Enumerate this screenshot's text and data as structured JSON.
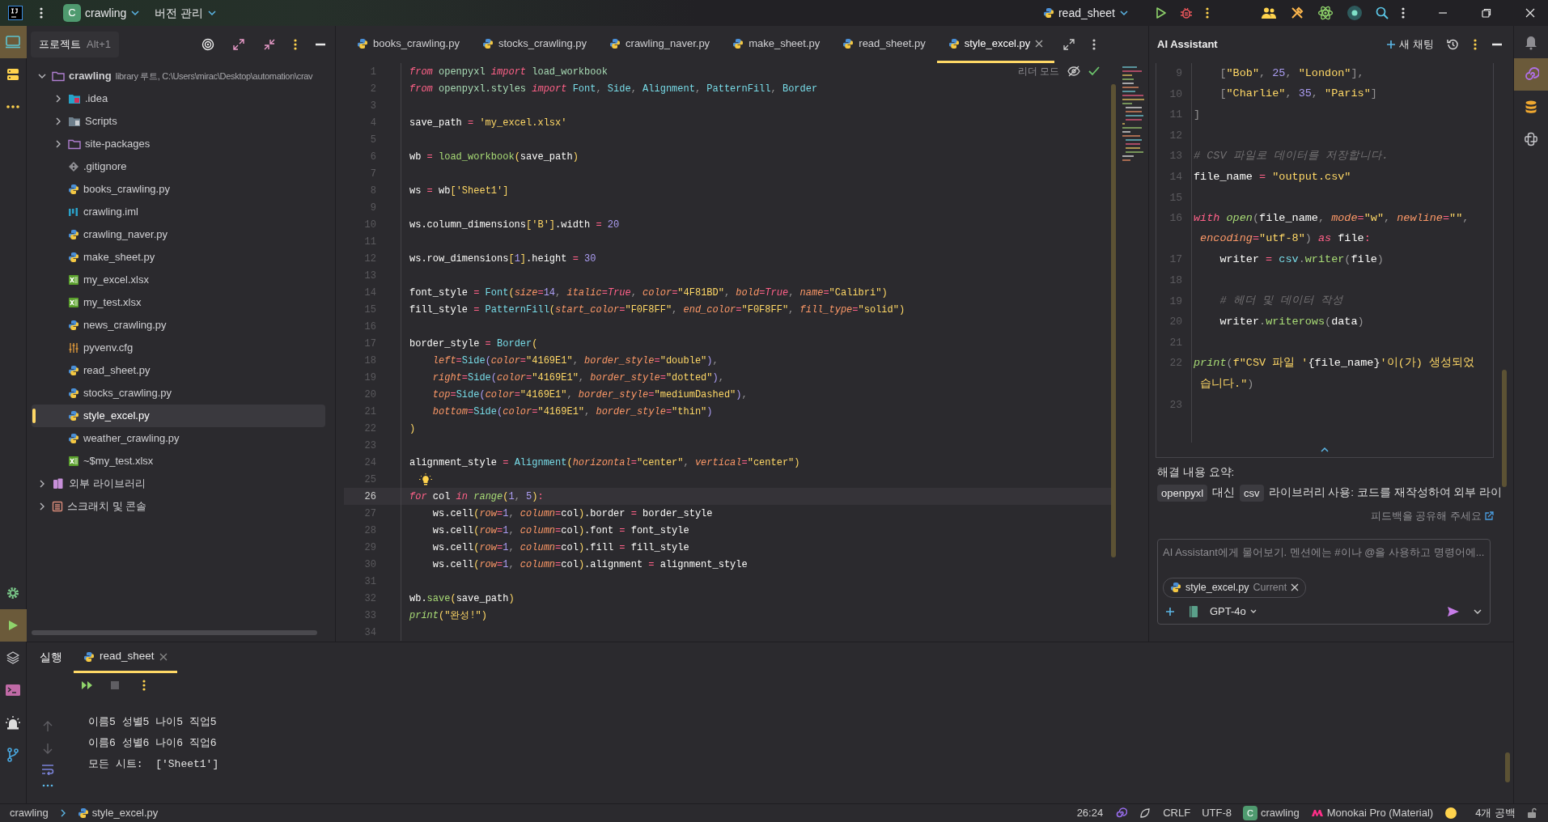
{
  "title_bar": {
    "project_badge": "C",
    "project": "crawling",
    "vcs": "버전 관리",
    "run_config": "read_sheet"
  },
  "left_toolbar": [
    {
      "kind": "project",
      "selected": true
    },
    {
      "kind": "services",
      "selected": false
    },
    {
      "kind": "more",
      "selected": false
    }
  ],
  "left_toolbar_bottom": [
    {
      "kind": "settings",
      "selected": false
    },
    {
      "kind": "run",
      "selected": true
    },
    {
      "kind": "layers",
      "selected": false
    },
    {
      "kind": "terminal",
      "selected": false
    },
    {
      "kind": "problems",
      "selected": false
    },
    {
      "kind": "git",
      "selected": false
    }
  ],
  "right_toolbar": [
    {
      "kind": "ai",
      "selected": true
    },
    {
      "kind": "database",
      "selected": false
    },
    {
      "kind": "python",
      "selected": false
    }
  ],
  "project_panel": {
    "tooltip_title": "프로젝트",
    "tooltip_shortcut": "Alt+1",
    "tree": [
      {
        "label": "crawling",
        "detail": "library 루트, C:\\Users\\mirac\\Desktop\\automation\\crav",
        "kind": "folder",
        "expanded": true,
        "selected": false,
        "children": [
          {
            "label": ".idea",
            "kind": "folder_idea",
            "expanded": false,
            "selected": false
          },
          {
            "label": "Scripts",
            "kind": "folder_scripts",
            "expanded": false,
            "selected": false
          },
          {
            "label": "site-packages",
            "kind": "folder",
            "expanded": false,
            "selected": false
          },
          {
            "label": ".gitignore",
            "kind": "git",
            "selected": false
          },
          {
            "label": "books_crawling.py",
            "kind": "python",
            "selected": false
          },
          {
            "label": "crawling.iml",
            "kind": "iml",
            "selected": false
          },
          {
            "label": "crawling_naver.py",
            "kind": "python",
            "selected": false
          },
          {
            "label": "make_sheet.py",
            "kind": "python",
            "selected": false
          },
          {
            "label": "my_excel.xlsx",
            "kind": "excel",
            "selected": false
          },
          {
            "label": "my_test.xlsx",
            "kind": "excel",
            "selected": false
          },
          {
            "label": "news_crawling.py",
            "kind": "python",
            "selected": false
          },
          {
            "label": "pyvenv.cfg",
            "kind": "cfg",
            "selected": false
          },
          {
            "label": "read_sheet.py",
            "kind": "python",
            "selected": false
          },
          {
            "label": "stocks_crawling.py",
            "kind": "python",
            "selected": false
          },
          {
            "label": "style_excel.py",
            "kind": "python",
            "selected": true
          },
          {
            "label": "weather_crawling.py",
            "kind": "python",
            "selected": false
          },
          {
            "label": "~$my_test.xlsx",
            "kind": "excel",
            "selected": false
          }
        ]
      },
      {
        "label": "외부 라이브러리",
        "kind": "library",
        "expanded": false,
        "selected": false
      },
      {
        "label": "스크래치 및 콘솔",
        "kind": "scratch",
        "expanded": false,
        "selected": false
      }
    ]
  },
  "editor": {
    "tabs": [
      {
        "label": "books_crawling.py",
        "selected": false
      },
      {
        "label": "stocks_crawling.py",
        "selected": false
      },
      {
        "label": "crawling_naver.py",
        "selected": false
      },
      {
        "label": "make_sheet.py",
        "selected": false
      },
      {
        "label": "read_sheet.py",
        "selected": false
      },
      {
        "label": "style_excel.py",
        "selected": true
      }
    ],
    "reader_mode": "리더 모드",
    "lines": [
      {
        "no": "1",
        "current": false,
        "code": [
          {
            "kind": "kw",
            "text": "from"
          },
          {
            "kind": "mod",
            "text": " openpyxl"
          },
          {
            "kind": "kw",
            "text": " import"
          },
          {
            "kind": "mod",
            "text": " load_workbook"
          }
        ]
      },
      {
        "no": "2",
        "current": false,
        "code": [
          {
            "kind": "kw",
            "text": "from"
          },
          {
            "kind": "mod",
            "text": " openpyxl.styles"
          },
          {
            "kind": "kw",
            "text": " import"
          },
          {
            "kind": "cls",
            "text": " Font"
          },
          {
            "kind": "pu",
            "text": ","
          },
          {
            "kind": "cls",
            "text": " Side"
          },
          {
            "kind": "pu",
            "text": ","
          },
          {
            "kind": "cls",
            "text": " Alignment"
          },
          {
            "kind": "pu",
            "text": ","
          },
          {
            "kind": "cls",
            "text": " PatternFill"
          },
          {
            "kind": "pu",
            "text": ","
          },
          {
            "kind": "cls",
            "text": " Border"
          }
        ]
      },
      {
        "no": "3",
        "current": false
      },
      {
        "no": "4",
        "current": false,
        "code": [
          {
            "kind": "p",
            "text": "save_path"
          },
          {
            "kind": "op",
            "text": " ="
          },
          {
            "kind": "str",
            "text": " 'my_excel.xlsx'"
          }
        ]
      },
      {
        "no": "5",
        "current": false
      },
      {
        "no": "6",
        "current": false,
        "code": [
          {
            "kind": "p",
            "text": "wb"
          },
          {
            "kind": "op",
            "text": " ="
          },
          {
            "kind": "fn",
            "text": " load_workbook"
          },
          {
            "kind": "br",
            "text": "("
          },
          {
            "kind": "p",
            "text": "save_path"
          },
          {
            "kind": "br",
            "text": ")"
          }
        ]
      },
      {
        "no": "7",
        "current": false
      },
      {
        "no": "8",
        "current": false,
        "code": [
          {
            "kind": "p",
            "text": "ws"
          },
          {
            "kind": "op",
            "text": " ="
          },
          {
            "kind": "p",
            "text": " wb"
          },
          {
            "kind": "br",
            "text": "["
          },
          {
            "kind": "str",
            "text": "'Sheet1'"
          },
          {
            "kind": "br",
            "text": "]"
          }
        ]
      },
      {
        "no": "9",
        "current": false
      },
      {
        "no": "10",
        "current": false,
        "code": [
          {
            "kind": "p",
            "text": "ws.column_dimensions"
          },
          {
            "kind": "br",
            "text": "["
          },
          {
            "kind": "str",
            "text": "'B'"
          },
          {
            "kind": "br",
            "text": "]"
          },
          {
            "kind": "p",
            "text": ".width"
          },
          {
            "kind": "op",
            "text": " ="
          },
          {
            "kind": "num",
            "text": " 20"
          }
        ]
      },
      {
        "no": "11",
        "current": false
      },
      {
        "no": "12",
        "current": false,
        "code": [
          {
            "kind": "p",
            "text": "ws.row_dimensions"
          },
          {
            "kind": "br",
            "text": "["
          },
          {
            "kind": "num",
            "text": "1"
          },
          {
            "kind": "br",
            "text": "]"
          },
          {
            "kind": "p",
            "text": ".height"
          },
          {
            "kind": "op",
            "text": " ="
          },
          {
            "kind": "num",
            "text": " 30"
          }
        ]
      },
      {
        "no": "13",
        "current": false
      },
      {
        "no": "14",
        "current": false,
        "code": [
          {
            "kind": "p",
            "text": "font_style"
          },
          {
            "kind": "op",
            "text": " ="
          },
          {
            "kind": "cls",
            "text": " Font"
          },
          {
            "kind": "br",
            "text": "("
          },
          {
            "kind": "prm",
            "text": "size"
          },
          {
            "kind": "op",
            "text": "="
          },
          {
            "kind": "num",
            "text": "14"
          },
          {
            "kind": "pu",
            "text": ","
          },
          {
            "kind": "prm",
            "text": " italic"
          },
          {
            "kind": "op",
            "text": "="
          },
          {
            "kind": "kw",
            "text": "True"
          },
          {
            "kind": "pu",
            "text": ","
          },
          {
            "kind": "prm",
            "text": " color"
          },
          {
            "kind": "op",
            "text": "="
          },
          {
            "kind": "str",
            "text": "\"4F81BD\""
          },
          {
            "kind": "pu",
            "text": ","
          },
          {
            "kind": "prm",
            "text": " bold"
          },
          {
            "kind": "op",
            "text": "="
          },
          {
            "kind": "kw",
            "text": "True"
          },
          {
            "kind": "pu",
            "text": ","
          },
          {
            "kind": "prm",
            "text": " name"
          },
          {
            "kind": "op",
            "text": "="
          },
          {
            "kind": "str",
            "text": "\"Calibri\""
          },
          {
            "kind": "br",
            "text": ")"
          }
        ]
      },
      {
        "no": "15",
        "current": false,
        "code": [
          {
            "kind": "p",
            "text": "fill_style"
          },
          {
            "kind": "op",
            "text": " ="
          },
          {
            "kind": "cls",
            "text": " PatternFill"
          },
          {
            "kind": "br",
            "text": "("
          },
          {
            "kind": "prm",
            "text": "start_color"
          },
          {
            "kind": "op",
            "text": "="
          },
          {
            "kind": "str",
            "text": "\"F0F8FF\""
          },
          {
            "kind": "pu",
            "text": ","
          },
          {
            "kind": "prm",
            "text": " end_color"
          },
          {
            "kind": "op",
            "text": "="
          },
          {
            "kind": "str",
            "text": "\"F0F8FF\""
          },
          {
            "kind": "pu",
            "text": ","
          },
          {
            "kind": "prm",
            "text": " fill_type"
          },
          {
            "kind": "op",
            "text": "="
          },
          {
            "kind": "str",
            "text": "\"solid\""
          },
          {
            "kind": "br",
            "text": ")"
          }
        ]
      },
      {
        "no": "16",
        "current": false
      },
      {
        "no": "17",
        "current": false,
        "code": [
          {
            "kind": "p",
            "text": "border_style"
          },
          {
            "kind": "op",
            "text": " ="
          },
          {
            "kind": "cls",
            "text": " Border"
          },
          {
            "kind": "br",
            "text": "("
          }
        ]
      },
      {
        "no": "18",
        "current": false,
        "code": [
          {
            "kind": "prm",
            "text": "    left"
          },
          {
            "kind": "op",
            "text": "="
          },
          {
            "kind": "cls",
            "text": "Side"
          },
          {
            "kind": "br2",
            "text": "("
          },
          {
            "kind": "prm",
            "text": "color"
          },
          {
            "kind": "op",
            "text": "="
          },
          {
            "kind": "str",
            "text": "\"4169E1\""
          },
          {
            "kind": "pu",
            "text": ","
          },
          {
            "kind": "prm",
            "text": " border_style"
          },
          {
            "kind": "op",
            "text": "="
          },
          {
            "kind": "str",
            "text": "\"double\""
          },
          {
            "kind": "br2",
            "text": ")"
          },
          {
            "kind": "pu",
            "text": ","
          }
        ]
      },
      {
        "no": "19",
        "current": false,
        "code": [
          {
            "kind": "prm",
            "text": "    right"
          },
          {
            "kind": "op",
            "text": "="
          },
          {
            "kind": "cls",
            "text": "Side"
          },
          {
            "kind": "br2",
            "text": "("
          },
          {
            "kind": "prm",
            "text": "color"
          },
          {
            "kind": "op",
            "text": "="
          },
          {
            "kind": "str",
            "text": "\"4169E1\""
          },
          {
            "kind": "pu",
            "text": ","
          },
          {
            "kind": "prm",
            "text": " border_style"
          },
          {
            "kind": "op",
            "text": "="
          },
          {
            "kind": "str",
            "text": "\"dotted\""
          },
          {
            "kind": "br2",
            "text": ")"
          },
          {
            "kind": "pu",
            "text": ","
          }
        ]
      },
      {
        "no": "20",
        "current": false,
        "code": [
          {
            "kind": "prm",
            "text": "    top"
          },
          {
            "kind": "op",
            "text": "="
          },
          {
            "kind": "cls",
            "text": "Side"
          },
          {
            "kind": "br2",
            "text": "("
          },
          {
            "kind": "prm",
            "text": "color"
          },
          {
            "kind": "op",
            "text": "="
          },
          {
            "kind": "str",
            "text": "\"4169E1\""
          },
          {
            "kind": "pu",
            "text": ","
          },
          {
            "kind": "prm",
            "text": " border_style"
          },
          {
            "kind": "op",
            "text": "="
          },
          {
            "kind": "str",
            "text": "\"mediumDashed\""
          },
          {
            "kind": "br2",
            "text": ")"
          },
          {
            "kind": "pu",
            "text": ","
          }
        ]
      },
      {
        "no": "21",
        "current": false,
        "code": [
          {
            "kind": "prm",
            "text": "    bottom"
          },
          {
            "kind": "op",
            "text": "="
          },
          {
            "kind": "cls",
            "text": "Side"
          },
          {
            "kind": "br2",
            "text": "("
          },
          {
            "kind": "prm",
            "text": "color"
          },
          {
            "kind": "op",
            "text": "="
          },
          {
            "kind": "str",
            "text": "\"4169E1\""
          },
          {
            "kind": "pu",
            "text": ","
          },
          {
            "kind": "prm",
            "text": " border_style"
          },
          {
            "kind": "op",
            "text": "="
          },
          {
            "kind": "str",
            "text": "\"thin\""
          },
          {
            "kind": "br2",
            "text": ")"
          }
        ]
      },
      {
        "no": "22",
        "current": false,
        "code": [
          {
            "kind": "br",
            "text": ")"
          }
        ]
      },
      {
        "no": "23",
        "current": false
      },
      {
        "no": "24",
        "current": false,
        "code": [
          {
            "kind": "p",
            "text": "alignment_style"
          },
          {
            "kind": "op",
            "text": " ="
          },
          {
            "kind": "cls",
            "text": " Alignment"
          },
          {
            "kind": "br",
            "text": "("
          },
          {
            "kind": "prm",
            "text": "horizontal"
          },
          {
            "kind": "op",
            "text": "="
          },
          {
            "kind": "str",
            "text": "\"center\""
          },
          {
            "kind": "pu",
            "text": ","
          },
          {
            "kind": "prm",
            "text": " vertical"
          },
          {
            "kind": "op",
            "text": "="
          },
          {
            "kind": "str",
            "text": "\"center\""
          },
          {
            "kind": "br",
            "text": ")"
          }
        ]
      },
      {
        "no": "25",
        "current": false,
        "bulb": true
      },
      {
        "no": "26",
        "current": true,
        "code": [
          {
            "kind": "kw",
            "text": "for"
          },
          {
            "kind": "p",
            "text": " col"
          },
          {
            "kind": "kw",
            "text": " in"
          },
          {
            "kind": "bi",
            "text": " range"
          },
          {
            "kind": "br",
            "text": "("
          },
          {
            "kind": "num",
            "text": "1"
          },
          {
            "kind": "pu",
            "text": ","
          },
          {
            "kind": "num",
            "text": " 5"
          },
          {
            "kind": "br",
            "text": ")"
          },
          {
            "kind": "op",
            "text": ":"
          }
        ]
      },
      {
        "no": "27",
        "current": false,
        "code": [
          {
            "kind": "p",
            "text": "    ws.cell"
          },
          {
            "kind": "br",
            "text": "("
          },
          {
            "kind": "prm",
            "text": "row"
          },
          {
            "kind": "op",
            "text": "="
          },
          {
            "kind": "num",
            "text": "1"
          },
          {
            "kind": "pu",
            "text": ","
          },
          {
            "kind": "prm",
            "text": " column"
          },
          {
            "kind": "op",
            "text": "="
          },
          {
            "kind": "p",
            "text": "col"
          },
          {
            "kind": "br",
            "text": ")"
          },
          {
            "kind": "p",
            "text": ".border"
          },
          {
            "kind": "op",
            "text": " ="
          },
          {
            "kind": "p",
            "text": " border_style"
          }
        ]
      },
      {
        "no": "28",
        "current": false,
        "code": [
          {
            "kind": "p",
            "text": "    ws.cell"
          },
          {
            "kind": "br",
            "text": "("
          },
          {
            "kind": "prm",
            "text": "row"
          },
          {
            "kind": "op",
            "text": "="
          },
          {
            "kind": "num",
            "text": "1"
          },
          {
            "kind": "pu",
            "text": ","
          },
          {
            "kind": "prm",
            "text": " column"
          },
          {
            "kind": "op",
            "text": "="
          },
          {
            "kind": "p",
            "text": "col"
          },
          {
            "kind": "br",
            "text": ")"
          },
          {
            "kind": "p",
            "text": ".font"
          },
          {
            "kind": "op",
            "text": " ="
          },
          {
            "kind": "p",
            "text": " font_style"
          }
        ]
      },
      {
        "no": "29",
        "current": false,
        "code": [
          {
            "kind": "p",
            "text": "    ws.cell"
          },
          {
            "kind": "br",
            "text": "("
          },
          {
            "kind": "prm",
            "text": "row"
          },
          {
            "kind": "op",
            "text": "="
          },
          {
            "kind": "num",
            "text": "1"
          },
          {
            "kind": "pu",
            "text": ","
          },
          {
            "kind": "prm",
            "text": " column"
          },
          {
            "kind": "op",
            "text": "="
          },
          {
            "kind": "p",
            "text": "col"
          },
          {
            "kind": "br",
            "text": ")"
          },
          {
            "kind": "p",
            "text": ".fill"
          },
          {
            "kind": "op",
            "text": " ="
          },
          {
            "kind": "p",
            "text": " fill_style"
          }
        ]
      },
      {
        "no": "30",
        "current": false,
        "code": [
          {
            "kind": "p",
            "text": "    ws.cell"
          },
          {
            "kind": "br",
            "text": "("
          },
          {
            "kind": "prm",
            "text": "row"
          },
          {
            "kind": "op",
            "text": "="
          },
          {
            "kind": "num",
            "text": "1"
          },
          {
            "kind": "pu",
            "text": ","
          },
          {
            "kind": "prm",
            "text": " column"
          },
          {
            "kind": "op",
            "text": "="
          },
          {
            "kind": "p",
            "text": "col"
          },
          {
            "kind": "br",
            "text": ")"
          },
          {
            "kind": "p",
            "text": ".alignment"
          },
          {
            "kind": "op",
            "text": " ="
          },
          {
            "kind": "p",
            "text": " alignment_style"
          }
        ]
      },
      {
        "no": "31",
        "current": false
      },
      {
        "no": "32",
        "current": false,
        "code": [
          {
            "kind": "p",
            "text": "wb."
          },
          {
            "kind": "fn",
            "text": "save"
          },
          {
            "kind": "br",
            "text": "("
          },
          {
            "kind": "p",
            "text": "save_path"
          },
          {
            "kind": "br",
            "text": ")"
          }
        ]
      },
      {
        "no": "33",
        "current": false,
        "code": [
          {
            "kind": "bi",
            "text": "print"
          },
          {
            "kind": "br",
            "text": "("
          },
          {
            "kind": "str",
            "text": "\"완성!\""
          },
          {
            "kind": "br",
            "text": ")"
          }
        ]
      },
      {
        "no": "34",
        "current": false
      }
    ]
  },
  "ai_assistant": {
    "title": "AI Assistant",
    "new_chat": "새 채팅",
    "code_lines": [
      {
        "no": "9",
        "code": [
          {
            "kind": "pu",
            "text": "    ["
          },
          {
            "kind": "str",
            "text": "\"Bob\""
          },
          {
            "kind": "pu",
            "text": ","
          },
          {
            "kind": "num",
            "text": " 25"
          },
          {
            "kind": "pu",
            "text": ","
          },
          {
            "kind": "str",
            "text": " \"London\""
          },
          {
            "kind": "pu",
            "text": "],"
          }
        ]
      },
      {
        "no": "10",
        "code": [
          {
            "kind": "pu",
            "text": "    ["
          },
          {
            "kind": "str",
            "text": "\"Charlie\""
          },
          {
            "kind": "pu",
            "text": ","
          },
          {
            "kind": "num",
            "text": " 35"
          },
          {
            "kind": "pu",
            "text": ","
          },
          {
            "kind": "str",
            "text": " \"Paris\""
          },
          {
            "kind": "pu",
            "text": "]"
          }
        ]
      },
      {
        "no": "11",
        "code": [
          {
            "kind": "pu",
            "text": "]"
          }
        ]
      },
      {
        "no": "12"
      },
      {
        "no": "13",
        "code": [
          {
            "kind": "cm",
            "text": "# CSV 파일로 데이터를 저장합니다."
          }
        ]
      },
      {
        "no": "14",
        "code": [
          {
            "kind": "p",
            "text": "file_name"
          },
          {
            "kind": "op",
            "text": " ="
          },
          {
            "kind": "str",
            "text": " \"output.csv\""
          }
        ]
      },
      {
        "no": "15"
      },
      {
        "no": "16",
        "code": [
          {
            "kind": "kw",
            "text": "with"
          },
          {
            "kind": "bi",
            "text": " open"
          },
          {
            "kind": "pu",
            "text": "("
          },
          {
            "kind": "p",
            "text": "file_name"
          },
          {
            "kind": "pu",
            "text": ","
          },
          {
            "kind": "prm",
            "text": " mode"
          },
          {
            "kind": "op",
            "text": "="
          },
          {
            "kind": "str",
            "text": "\"w\""
          },
          {
            "kind": "pu",
            "text": ","
          },
          {
            "kind": "prm",
            "text": " newline"
          },
          {
            "kind": "op",
            "text": "="
          },
          {
            "kind": "str",
            "text": "\"\""
          },
          {
            "kind": "pu",
            "text": ","
          }
        ]
      },
      {
        "code": [
          {
            "kind": "prm",
            "text": " encoding"
          },
          {
            "kind": "op",
            "text": "="
          },
          {
            "kind": "str",
            "text": "\"utf-8\""
          },
          {
            "kind": "pu",
            "text": ")"
          },
          {
            "kind": "kw",
            "text": " as"
          },
          {
            "kind": "p",
            "text": " file"
          },
          {
            "kind": "op",
            "text": ":"
          }
        ]
      },
      {
        "no": "17",
        "code": [
          {
            "kind": "p",
            "text": "    writer"
          },
          {
            "kind": "op",
            "text": " ="
          },
          {
            "kind": "cls",
            "text": " csv"
          },
          {
            "kind": "pu",
            "text": "."
          },
          {
            "kind": "fn",
            "text": "writer"
          },
          {
            "kind": "pu",
            "text": "("
          },
          {
            "kind": "p",
            "text": "file"
          },
          {
            "kind": "pu",
            "text": ")"
          }
        ]
      },
      {
        "no": "18"
      },
      {
        "no": "19",
        "code": [
          {
            "kind": "cm",
            "text": "    # 헤더 및 데이터 작성"
          }
        ]
      },
      {
        "no": "20",
        "code": [
          {
            "kind": "p",
            "text": "    writer"
          },
          {
            "kind": "pu",
            "text": "."
          },
          {
            "kind": "fn",
            "text": "writerows"
          },
          {
            "kind": "pu",
            "text": "("
          },
          {
            "kind": "p",
            "text": "data"
          },
          {
            "kind": "pu",
            "text": ")"
          }
        ]
      },
      {
        "no": "21"
      },
      {
        "no": "22",
        "code": [
          {
            "kind": "bi",
            "text": "print"
          },
          {
            "kind": "pu",
            "text": "("
          },
          {
            "kind": "str",
            "text": "f\"CSV 파일 '"
          },
          {
            "kind": "p",
            "text": "{file_name}"
          },
          {
            "kind": "str",
            "text": "'이(가) 생성되었"
          }
        ]
      },
      {
        "code": [
          {
            "kind": "str",
            "text": " 습니다.\""
          },
          {
            "kind": "pu",
            "text": ")"
          }
        ]
      },
      {
        "no": "23"
      }
    ],
    "summary_title": "해결 내용 요약:",
    "summary": [
      {
        "kind": "code",
        "text": "openpyxl"
      },
      {
        "kind": "text",
        "text": "대신"
      },
      {
        "kind": "code",
        "text": "csv"
      },
      {
        "kind": "text",
        "text": "라이브러리 사용: 코드를 재작성하여 외부 라이"
      }
    ],
    "feedback": "피드백을 공유해 주세요",
    "input": {
      "placeholder": "AI Assistant에게 물어보기. 멘션에는 #이나 @을 사용하고 명령어에..."
    },
    "context_file": {
      "name": "style_excel.py",
      "tag": "Current"
    },
    "model": "GPT-4o"
  },
  "run_panel": {
    "title": "실행",
    "tabs": [
      {
        "label": "read_sheet",
        "selected": true
      }
    ],
    "console": [
      "이름5 성별5 나이5 직업5",
      "이름6 성별6 나이6 직업6",
      "모든 시트:  ['Sheet1']"
    ]
  },
  "status_bar": {
    "breadcrumb": [
      "crawling",
      "style_excel.py"
    ],
    "position": "26:24",
    "line_separator": "CRLF",
    "encoding": "UTF-8",
    "project_badge": "C",
    "project": "crawling",
    "theme": "Monokai Pro (Material)",
    "indent": "4개 공백"
  }
}
